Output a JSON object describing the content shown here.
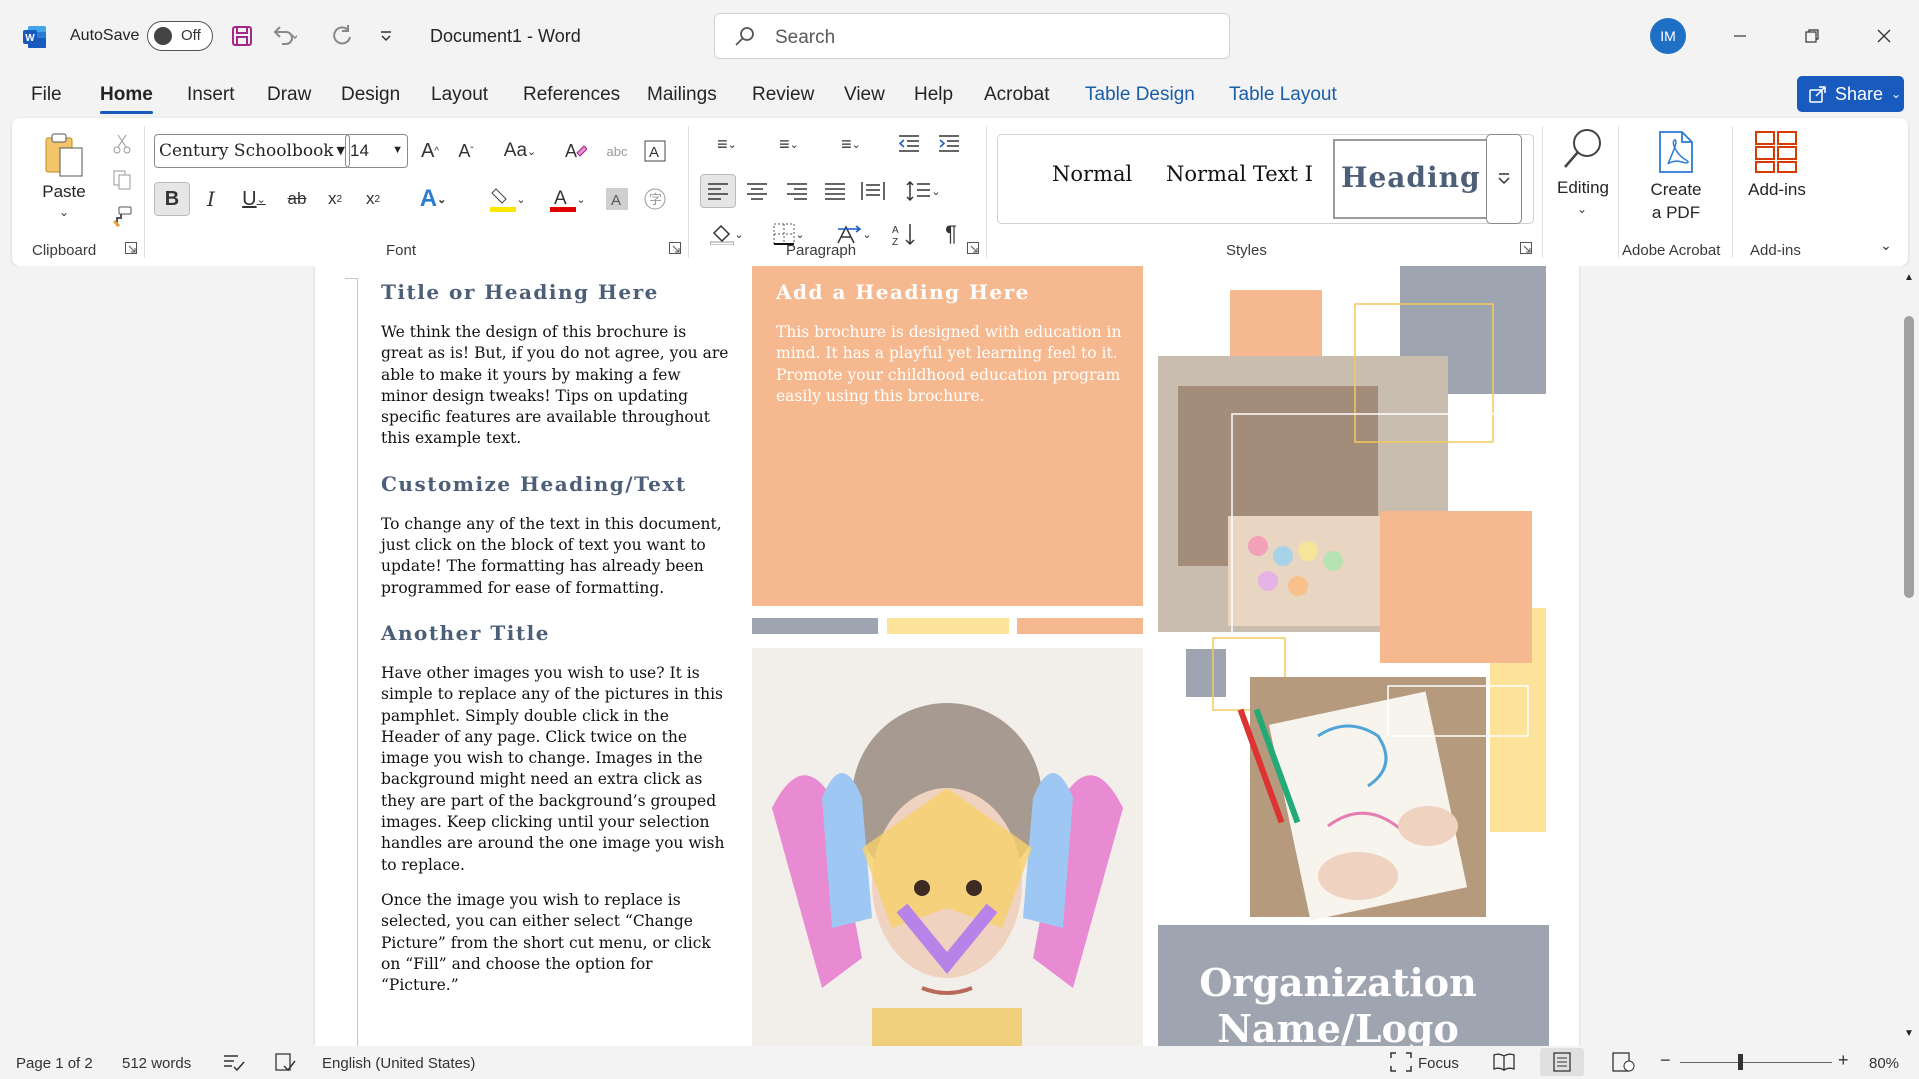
{
  "window": {
    "autosave_label": "AutoSave",
    "autosave_state": "Off",
    "document_title": "Document1  -  Word",
    "search_placeholder": "Search",
    "user_initials": "IM",
    "accent": "#185abd"
  },
  "tabs": [
    "File",
    "Home",
    "Insert",
    "Draw",
    "Design",
    "Layout",
    "References",
    "Mailings",
    "Review",
    "View",
    "Help",
    "Acrobat",
    "Table Design",
    "Table Layout"
  ],
  "active_tab": "Home",
  "share_label": "Share",
  "ribbon": {
    "clipboard": {
      "paste": "Paste",
      "label": "Clipboard"
    },
    "font": {
      "family": "Century Schoolbook",
      "size": "14",
      "label": "Font"
    },
    "paragraph": {
      "label": "Paragraph"
    },
    "styles": {
      "items": [
        "Normal",
        "Normal Text I",
        "Heading"
      ],
      "label": "Styles"
    },
    "editing": {
      "label": "Editing"
    },
    "adobe": {
      "create_pdf": "Create\na PDF",
      "create_pdf_line1": "Create",
      "create_pdf_line2": "a PDF",
      "label": "Adobe Acrobat"
    },
    "addins": {
      "button": "Add-ins",
      "label": "Add-ins"
    }
  },
  "document": {
    "col1": {
      "heading1": "Title or Heading Here",
      "para1": "We think the design of this brochure is great as is!  But, if you do not agree, you are able to make it yours by making a few minor design tweaks!  Tips on updating specific features are available throughout this example text.",
      "heading2": "Customize Heading/Text",
      "para2": "To change any of the text in this document, just click on the block of text you want to update!  The formatting has already been programmed for ease of formatting.",
      "heading3": "Another Title",
      "para3": "Have other images you wish to use?  It is simple to replace any of the pictures in this pamphlet.  Simply double click in the Header of any page.  Click twice on the image you wish to change.  Images in the background might need an extra click as they are part of the background’s grouped images.  Keep clicking until your selection handles are around the one image you wish to replace.",
      "para4": "Once the image you wish to replace is selected, you can either select “Change Picture” from the short cut menu, or click on “Fill” and choose the option for “Picture.”"
    },
    "col2": {
      "heading": "Add a Heading Here",
      "para": "This brochure is designed with education in mind.  It has a playful yet learning feel to it.  Promote your childhood education program easily using this brochure."
    },
    "col3": {
      "org_line1": "Organization",
      "org_line2": "Name/Logo"
    },
    "colors": {
      "orange": "#f6b98f",
      "gray": "#9ea4b0",
      "yellow": "#fde29a",
      "heading": "#4d5f78"
    }
  },
  "status": {
    "page": "Page 1 of 2",
    "words": "512 words",
    "language": "English (United States)",
    "focus": "Focus",
    "zoom": "80%"
  }
}
